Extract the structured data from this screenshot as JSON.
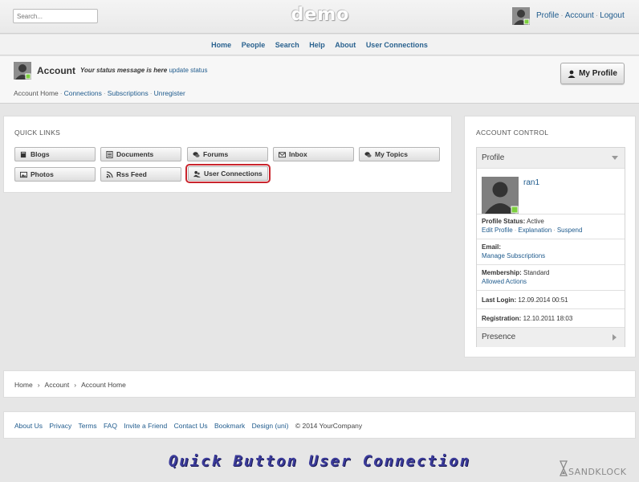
{
  "header": {
    "search_placeholder": "Search...",
    "logo": "demo",
    "links": [
      "Profile",
      "Account",
      "Logout"
    ]
  },
  "nav": {
    "items": [
      "Home",
      "People",
      "Search",
      "Help",
      "About",
      "User Connections"
    ]
  },
  "account": {
    "title": "Account",
    "status_message": "Your status message is here",
    "update_status": "update status",
    "links": [
      "Account Home",
      "Connections",
      "Subscriptions",
      "Unregister"
    ],
    "my_profile_label": "My Profile"
  },
  "quick_links": {
    "title": "QUICK LINKS",
    "buttons": [
      {
        "label": "Blogs",
        "icon": "book-icon"
      },
      {
        "label": "Documents",
        "icon": "document-icon"
      },
      {
        "label": "Forums",
        "icon": "chat-bubbles-icon"
      },
      {
        "label": "Inbox",
        "icon": "envelope-icon"
      },
      {
        "label": "My Topics",
        "icon": "chat-bubbles-icon"
      },
      {
        "label": "Photos",
        "icon": "image-icon"
      },
      {
        "label": "Rss Feed",
        "icon": "rss-icon"
      },
      {
        "label": "User Connections",
        "icon": "users-icon",
        "highlighted": true
      }
    ]
  },
  "account_control": {
    "title": "ACCOUNT CONTROL",
    "profile_header": "Profile",
    "username": "ran1",
    "profile_status_label": "Profile Status:",
    "profile_status_value": "Active",
    "profile_actions": [
      "Edit Profile",
      "Explanation",
      "Suspend"
    ],
    "email_label": "Email:",
    "email_action": "Manage Subscriptions",
    "membership_label": "Membership:",
    "membership_value": "Standard",
    "membership_action": "Allowed Actions",
    "last_login_label": "Last Login:",
    "last_login_value": "12.09.2014 00:51",
    "registration_label": "Registration:",
    "registration_value": "12.10.2011 18:03",
    "presence_header": "Presence"
  },
  "breadcrumb": [
    "Home",
    "Account",
    "Account Home"
  ],
  "footer": {
    "links": [
      "About Us",
      "Privacy",
      "Terms",
      "FAQ",
      "Invite a Friend",
      "Contact Us",
      "Bookmark",
      "Design (uni)"
    ],
    "copyright": "© 2014 YourCompany"
  },
  "caption": "Quick Button User Connection",
  "watermark": "SANDKLOCK",
  "colors": {
    "link": "#1f5b8d",
    "highlight_border": "#c9252d",
    "caption": "#3b3b9a",
    "online_badge": "#7ccf3e"
  }
}
